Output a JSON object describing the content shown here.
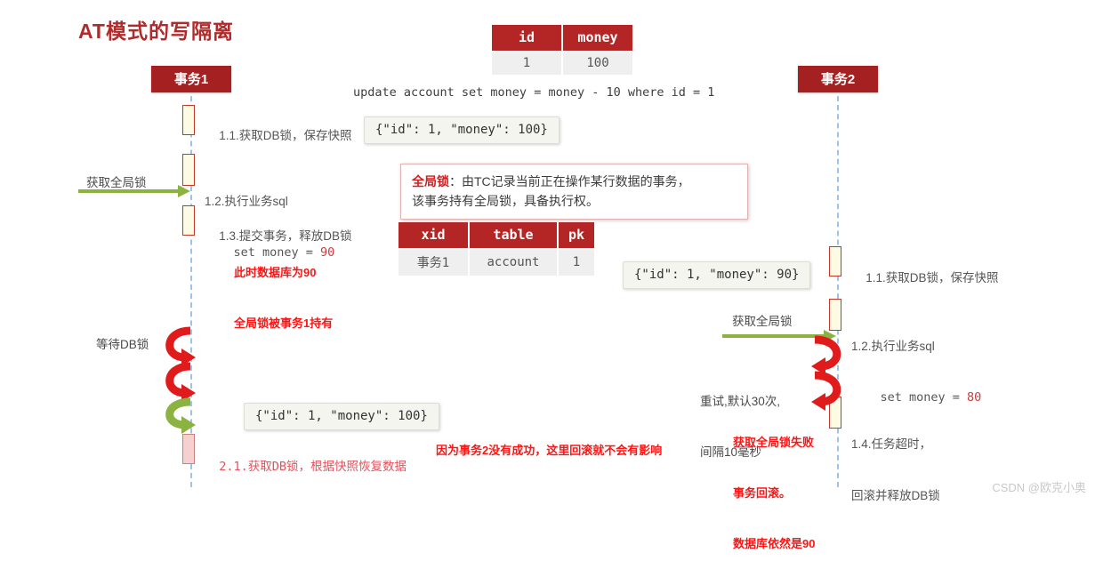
{
  "title": "AT模式的写隔离",
  "watermark": "CSDN @欧克小奥",
  "sql": "update account set money = money - 10 where id = 1",
  "account_table": {
    "headers": [
      "id",
      "money"
    ],
    "rows": [
      [
        "1",
        "100"
      ]
    ]
  },
  "lock_table": {
    "headers": [
      "xid",
      "table",
      "pk"
    ],
    "rows": [
      [
        "事务1",
        "account",
        "1"
      ]
    ]
  },
  "global_lock_note": {
    "label": "全局锁",
    "line1": "：由TC记录当前正在操作某行数据的事务，",
    "line2": "该事务持有全局锁，具备执行权。"
  },
  "tx1": {
    "actor": "事务1",
    "steps": [
      {
        "text": "1.1.获取DB锁，保存快照"
      },
      {
        "text": "1.2.执行业务sql",
        "sub": "    set money = ",
        "sub_value": "90"
      },
      {
        "text": "1.3.提交事务，释放DB锁"
      },
      {
        "text": "2.1.获取DB锁，根据快照恢复数据"
      }
    ],
    "annotations": {
      "db_value": "此时数据库为90",
      "lock_held": "全局锁被事务1持有",
      "wait_db_lock": "等待DB锁",
      "acquire_global_lock": "获取全局锁",
      "rollback_no_effect": "因为事务2没有成功，这里回滚就不会有影响"
    },
    "snapshots": [
      "{\"id\": 1, \"money\": 100}",
      "{\"id\": 1, \"money\": 100}"
    ]
  },
  "tx2": {
    "actor": "事务2",
    "steps": [
      {
        "text": "1.1.获取DB锁，保存快照"
      },
      {
        "text": "1.2.执行业务sql",
        "sub": "    set money = ",
        "sub_value": "80"
      },
      {
        "text": "1.4.任务超时，",
        "sub_cn": "回滚并释放DB锁"
      }
    ],
    "annotations": {
      "retry_line1": "重试,默认30次,",
      "retry_line2": "间隔10毫秒",
      "fail_line1": "获取全局锁失败",
      "fail_line2": "事务回滚。",
      "fail_line3": "数据库依然是90",
      "acquire_global_lock": "获取全局锁"
    },
    "snapshots": [
      "{\"id\": 1, \"money\": 90}"
    ]
  },
  "colors": {
    "brand_red": "#a52020",
    "accent_red": "#c0392b",
    "warn_red": "#ff1414",
    "lifeline_blue": "#9fc3e8",
    "arrow_green": "#8cb martin"
  }
}
